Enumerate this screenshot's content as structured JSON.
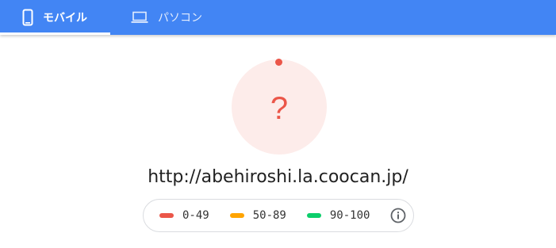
{
  "tabs": [
    {
      "label": "モバイル",
      "icon": "smartphone-icon",
      "selected": true
    },
    {
      "label": "パソコン",
      "icon": "laptop-icon",
      "selected": false
    }
  ],
  "report": {
    "score": "?",
    "url": "http://abehiroshi.la.coocan.jp/"
  },
  "legend": [
    {
      "range": "0-49",
      "color": "#eb5649"
    },
    {
      "range": "50-89",
      "color": "#ffa400"
    },
    {
      "range": "90-100",
      "color": "#0cce6b"
    }
  ],
  "colors": {
    "header": "#4285f4",
    "gauge_fill": "#fdecea",
    "gauge_accent": "#eb5649"
  }
}
